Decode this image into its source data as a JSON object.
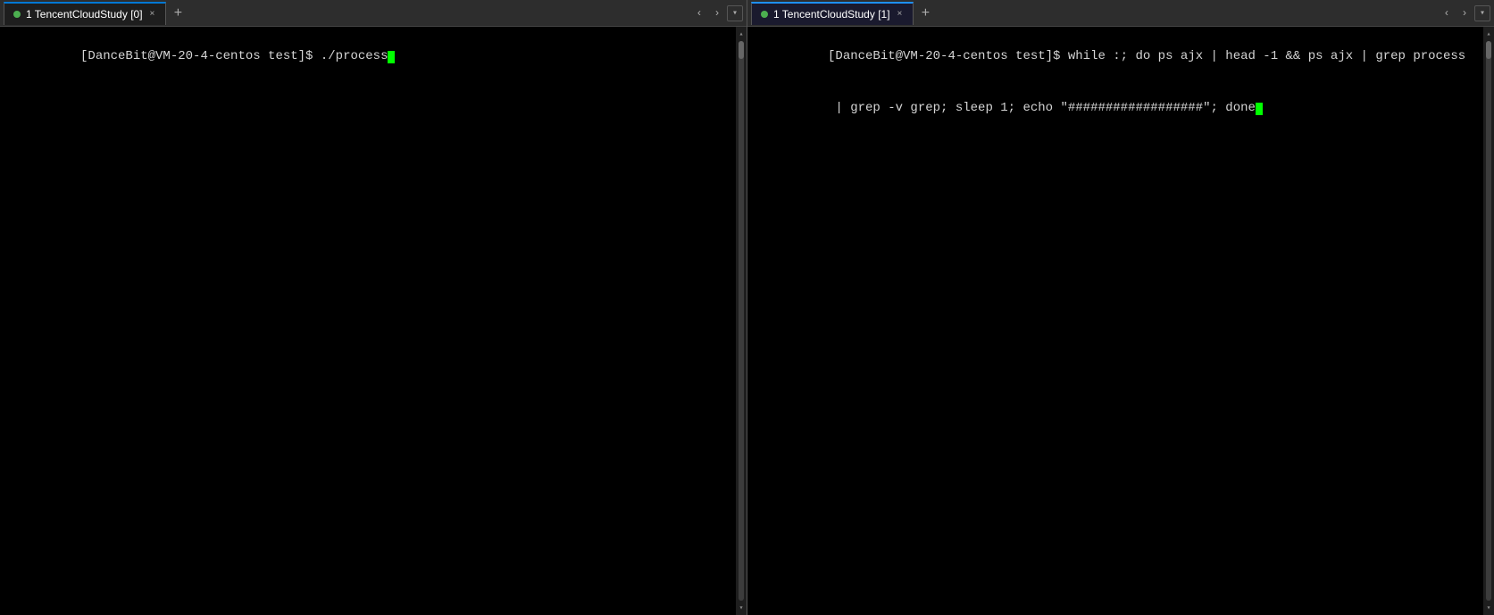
{
  "left_pane": {
    "tab_label": "1 TencentCloudStudy [0]",
    "tab_dot_color": "#4caf50",
    "prompt": "[DanceBit@VM-20-4-centos test]$",
    "command": " ./process",
    "cursor_visible": true
  },
  "right_pane": {
    "tab_label": "1 TencentCloudStudy [1]",
    "tab_dot_color": "#4caf50",
    "prompt": "[DanceBit@VM-20-4-centos test]$",
    "command_line1": " while :; do ps ajx | head -1 && ps ajx | grep process",
    "command_line2": " | grep -v grep; sleep 1; echo \"##################\"; done",
    "cursor_visible": true
  },
  "icons": {
    "close": "×",
    "add": "+",
    "arrow_left": "‹",
    "arrow_right": "›",
    "dropdown": "▾",
    "scroll_up": "▴",
    "scroll_down": "▾"
  }
}
